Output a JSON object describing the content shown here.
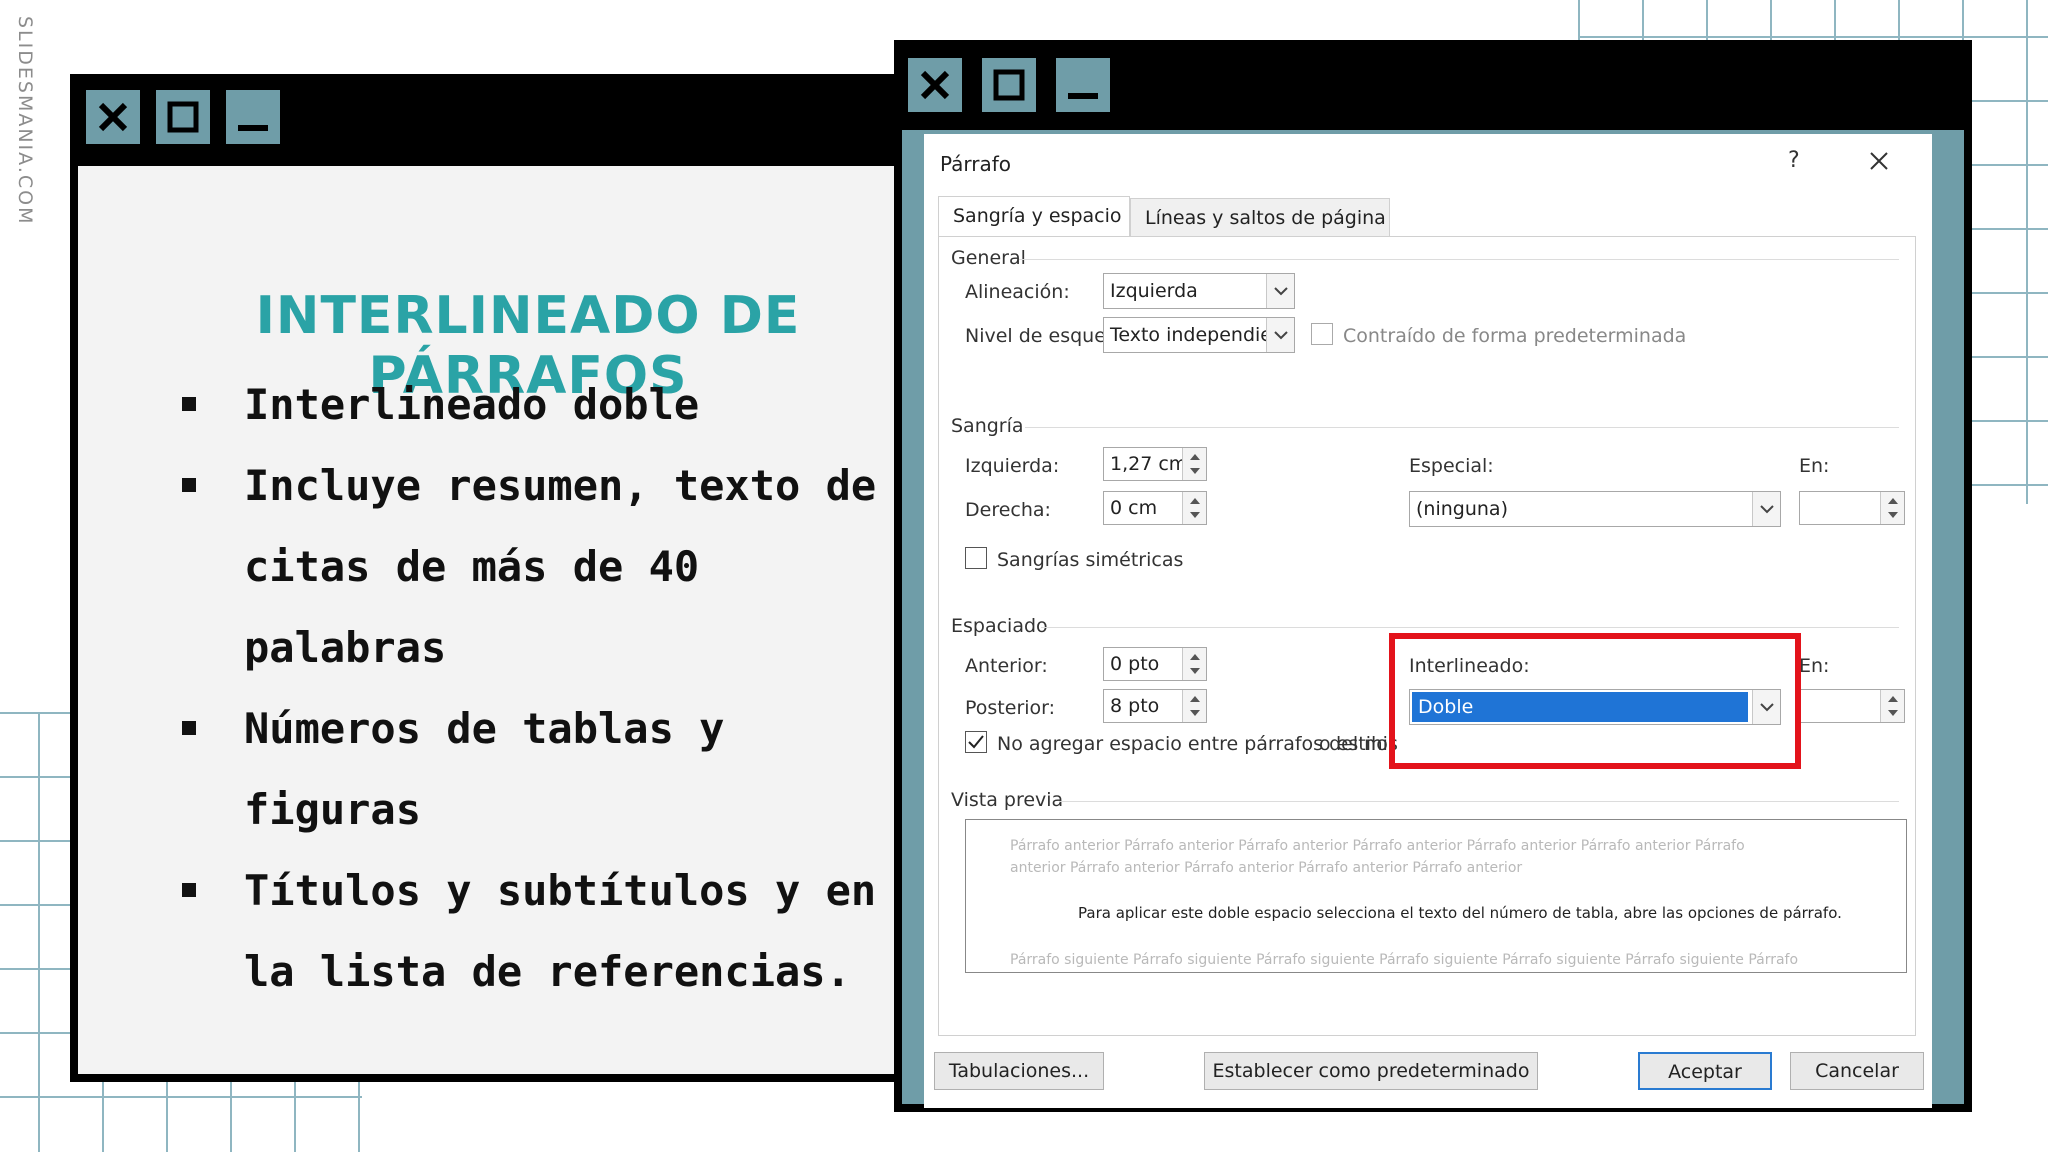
{
  "brand": "SLIDESMANIA.COM",
  "slide": {
    "title": "INTERLINEADO DE PÁRRAFOS",
    "bullets": [
      "Interlineado doble",
      "Incluye resumen, texto de citas de más de 40 palabras",
      "Números de tablas y figuras",
      "Títulos y subtítulos y en la lista de referencias."
    ]
  },
  "window_controls": {
    "close": "close-icon",
    "maximize": "maximize-icon",
    "minimize": "minimize-icon"
  },
  "dialog": {
    "title": "Párrafo",
    "help": "?",
    "tabs": [
      "Sangría y espacio",
      "Líneas y saltos de página"
    ],
    "general": {
      "group": "General",
      "alignment_label": "Alineación:",
      "alignment_value": "Izquierda",
      "outline_label": "Nivel de esquema:",
      "outline_value": "Texto independiente",
      "collapsed_label": "Contraído de forma predeterminada"
    },
    "indent": {
      "group": "Sangría",
      "left_label": "Izquierda:",
      "left_value": "1,27 cm",
      "right_label": "Derecha:",
      "right_value": "0 cm",
      "special_label": "Especial:",
      "special_value": "(ninguna)",
      "by_label": "En:",
      "mirror_label": "Sangrías simétricas"
    },
    "spacing": {
      "group": "Espaciado",
      "before_label": "Anterior:",
      "before_value": "0 pto",
      "after_label": "Posterior:",
      "after_value": "8 pto",
      "line_label": "Interlineado:",
      "line_value": "Doble",
      "at_label": "En:",
      "dont_add_label": "No agregar espacio entre párrafos del mis",
      "dont_add_label_tail": "o estilo",
      "dont_add_checked": true
    },
    "preview": {
      "group": "Vista previa",
      "prev_line1": "Párrafo anterior Párrafo anterior Párrafo anterior Párrafo anterior Párrafo anterior Párrafo anterior Párrafo",
      "prev_line2": "anterior Párrafo anterior Párrafo anterior Párrafo anterior Párrafo anterior",
      "main": "Para aplicar este doble espacio selecciona el texto del número de tabla, abre las opciones de párrafo.",
      "next_line": "Párrafo siguiente Párrafo siguiente Párrafo siguiente Párrafo siguiente Párrafo siguiente Párrafo siguiente Párrafo"
    },
    "buttons": {
      "tabs": "Tabulaciones...",
      "default": "Establecer como predeterminado",
      "ok": "Aceptar",
      "cancel": "Cancelar"
    }
  },
  "colors": {
    "accent_teal": "#2aa3a6",
    "chrome_teal": "#6f9da8",
    "highlight_red": "#e3131b",
    "selection_blue": "#1f74d6"
  }
}
